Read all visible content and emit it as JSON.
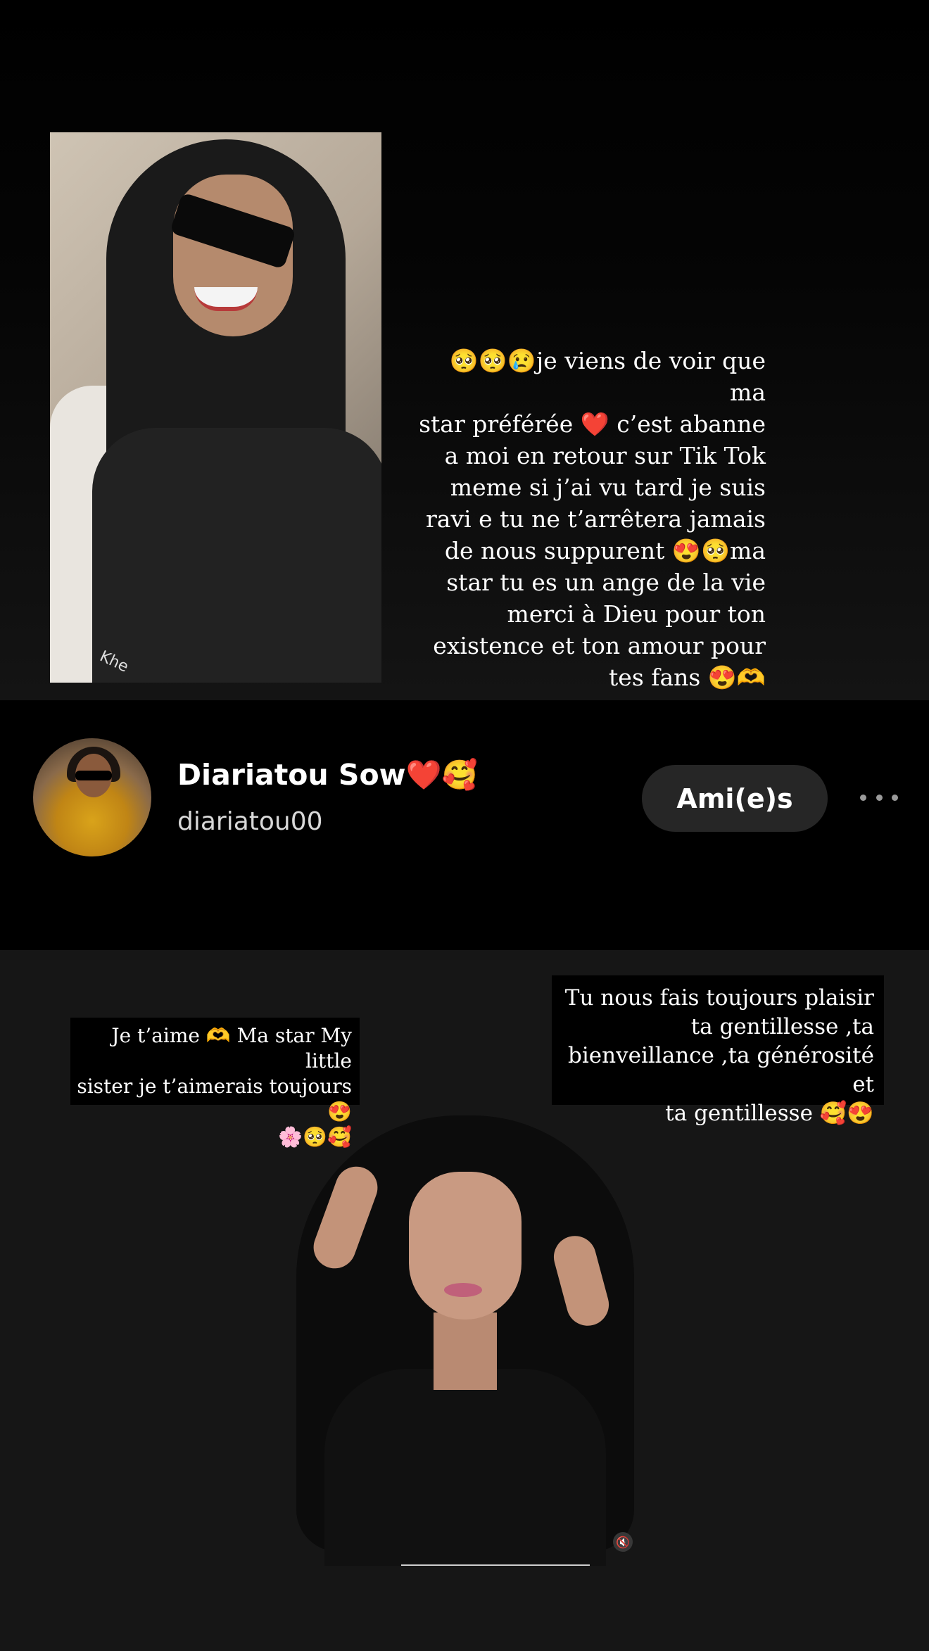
{
  "story": {
    "top_caption": "🥺🥺😢je viens de voir que ma\nstar préférée ❤️ c’est abanne\na moi en retour sur Tik Tok\nmeme si j’ai vu tard je suis\nravi e tu ne t’arrêtera jamais\nde nous  suppurent 😍🥺ma\nstar tu es un ange de la vie\nmerci à Dieu  pour ton\nexistence et ton amour pour\ntes fans 😍🫶",
    "photo_tag": "Khe"
  },
  "profile": {
    "display_name": "Diariatou Sow❤️🥰",
    "username": "diariatou00",
    "friends_button_label": "Ami(e)s",
    "more_icon": "more-horizontal-icon"
  },
  "bottom": {
    "left_bubble": "Je t’aime 🫶 Ma star My little\nsister je t’aimerais toujours 😍\n🌸🥺🥰",
    "right_bubble": "Tu nous fais toujours plaisir\nta gentillesse ,ta\nbienveillance ,ta générosité et\nta gentillesse 🥰😍",
    "mute_icon": "muted-speaker-icon"
  },
  "colors": {
    "background": "#000000",
    "bottom_background": "#161616",
    "button_background": "#262626",
    "text": "#ffffff",
    "secondary_text": "#d8d8d8"
  }
}
